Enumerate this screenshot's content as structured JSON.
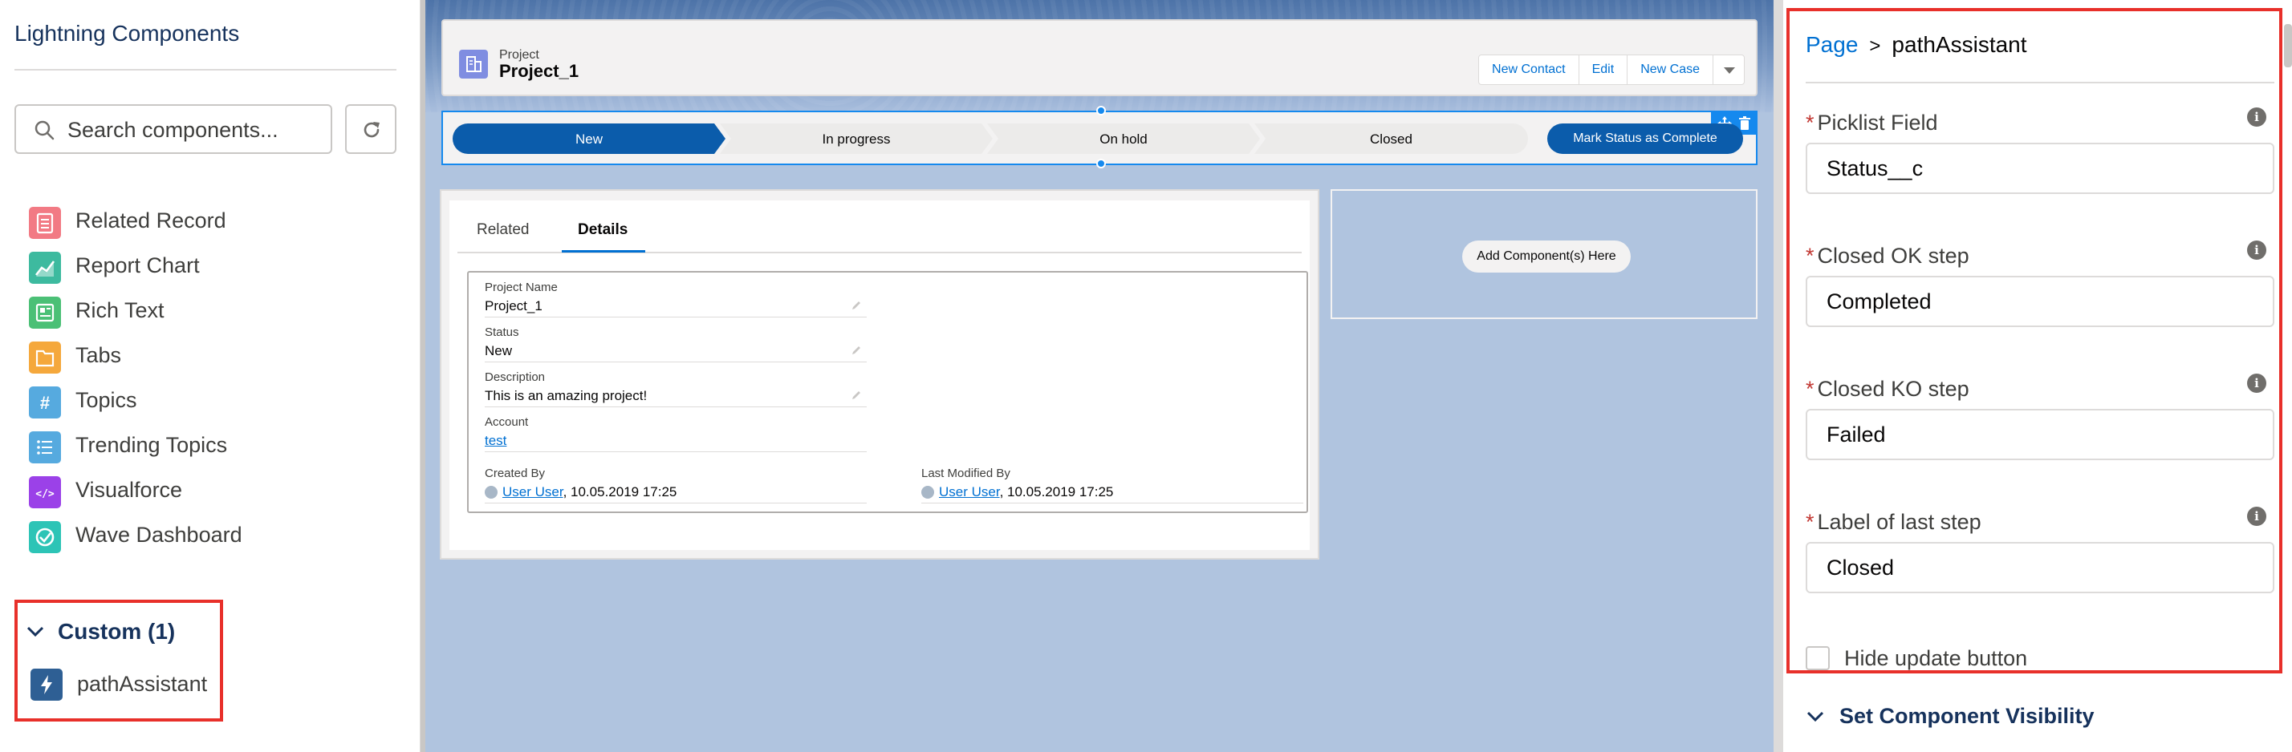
{
  "left_panel": {
    "title": "Lightning Components",
    "search": {
      "placeholder": "Search components..."
    },
    "components": [
      {
        "label": "Related Record",
        "icon": "related-record-icon",
        "color": "#f27a84"
      },
      {
        "label": "Report Chart",
        "icon": "report-chart-icon",
        "color": "#3dba9f"
      },
      {
        "label": "Rich Text",
        "icon": "rich-text-icon",
        "color": "#4bc076"
      },
      {
        "label": "Tabs",
        "icon": "tabs-icon",
        "color": "#f5a83c"
      },
      {
        "label": "Topics",
        "icon": "topics-icon",
        "color": "#56aadf"
      },
      {
        "label": "Trending Topics",
        "icon": "trending-topics-icon",
        "color": "#56aadf"
      },
      {
        "label": "Visualforce",
        "icon": "visualforce-icon",
        "color": "#9b41e8"
      },
      {
        "label": "Wave Dashboard",
        "icon": "wave-dashboard-icon",
        "color": "#2dc4b6"
      }
    ],
    "custom": {
      "header": "Custom (1)",
      "items": [
        {
          "label": "pathAssistant",
          "icon": "lightning-bolt-icon",
          "color": "#2e5f94"
        }
      ]
    }
  },
  "canvas": {
    "record": {
      "type_label": "Project",
      "name": "Project_1",
      "buttons": [
        "New Contact",
        "Edit",
        "New Case"
      ]
    },
    "path": {
      "steps": [
        "New",
        "In progress",
        "On hold",
        "Closed"
      ],
      "active_index": 0,
      "action_label": "Mark Status as Complete"
    },
    "details": {
      "tabs": [
        "Related",
        "Details"
      ],
      "active_tab": "Details",
      "fields": [
        {
          "label": "Project Name",
          "value": "Project_1"
        },
        {
          "label": "Status",
          "value": "New"
        },
        {
          "label": "Description",
          "value": "This is an amazing project!"
        },
        {
          "label": "Account",
          "value": "test"
        }
      ],
      "created_by": {
        "label": "Created By",
        "user": "User User",
        "date": ", 10.05.2019 17:25"
      },
      "last_modified_by": {
        "label": "Last Modified By",
        "user": "User User",
        "date": ", 10.05.2019 17:25"
      }
    },
    "placeholder_label": "Add Component(s) Here"
  },
  "right_panel": {
    "breadcrumb": {
      "parent": "Page",
      "separator": ">",
      "current": "pathAssistant"
    },
    "properties": [
      {
        "label": "Picklist Field",
        "value": "Status__c",
        "required": true
      },
      {
        "label": "Closed OK step",
        "value": "Completed",
        "required": true
      },
      {
        "label": "Closed KO step",
        "value": "Failed",
        "required": true
      },
      {
        "label": "Label of last step",
        "value": "Closed",
        "required": true
      }
    ],
    "hide_update_button": {
      "label": "Hide update button",
      "checked": false
    },
    "visibility_section": "Set Component Visibility"
  },
  "colors": {
    "brand_blue": "#0070d2",
    "path_active": "#0b5cab",
    "highlight_red": "#e8302a",
    "canvas_bg": "#b0c4df"
  }
}
